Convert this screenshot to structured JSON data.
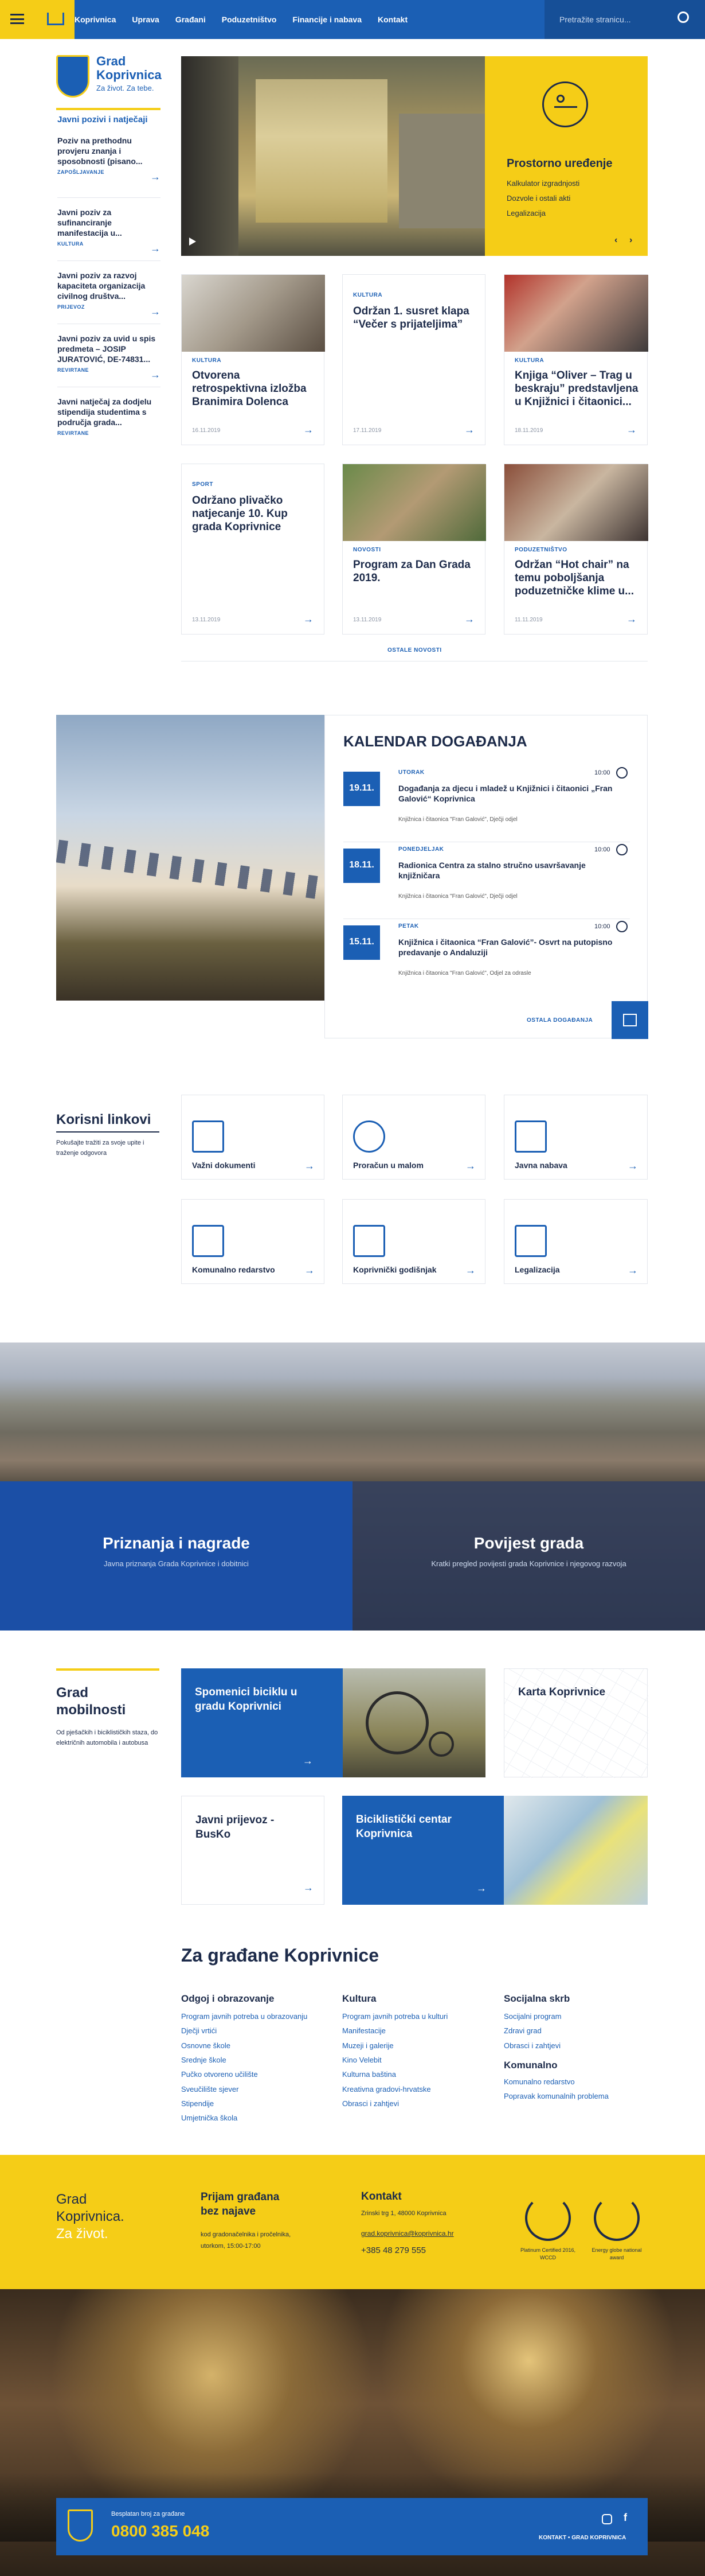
{
  "header": {
    "nav": [
      "Koprivnica",
      "Uprava",
      "Građani",
      "Poduzetništvo",
      "Financije i nabava",
      "Kontakt"
    ],
    "search_placeholder": "Pretražite stranicu..."
  },
  "logo": {
    "title1": "Grad",
    "title2": "Koprivnica",
    "slogan": "Za život. Za tebe."
  },
  "sidebar": {
    "heading": "Javni pozivi i natječaji",
    "items": [
      {
        "title": "Poziv na prethodnu provjeru znanja i sposobnosti (pisano...",
        "tag": "ZAPOŠLJAVANJE"
      },
      {
        "title": "Javni poziv za sufinanciranje manifestacija u...",
        "tag": "KULTURA"
      },
      {
        "title": "Javni poziv za razvoj kapaciteta organizacija civilnog društva...",
        "tag": "PRIJEVOZ"
      },
      {
        "title": "Javni poziv za uvid u spis predmeta – JOSIP JURATOVIĆ, DE-74831...",
        "tag": "REVIRTANE"
      },
      {
        "title": "Javni natječaj za dodjelu stipendija studentima s područja grada...",
        "tag": "REVIRTANE"
      }
    ]
  },
  "hero": {
    "panel_title": "Prostorno uređenje",
    "links": [
      "Kalkulator izgradnjosti",
      "Dozvole i ostali akti",
      "Legalizacija"
    ]
  },
  "news": [
    {
      "tag": "KULTURA",
      "title": "Otvorena retrospektivna izložba Branimira Dolenca",
      "date": "16.11.2019"
    },
    {
      "tag": "KULTURA",
      "title": "Održan 1. susret klapa “Večer s prijateljima”",
      "date": "17.11.2019"
    },
    {
      "tag": "KULTURA",
      "title": "Knjiga “Oliver – Trag u beskraju” predstavljena u Knjižnici i čitaonici...",
      "date": "18.11.2019"
    },
    {
      "tag": "SPORT",
      "title": "Održano plivačko natjecanje 10. Kup grada Koprivnice",
      "date": "13.11.2019"
    },
    {
      "tag": "NOVOSTI",
      "title": "Program za Dan Grada 2019.",
      "date": "13.11.2019"
    },
    {
      "tag": "PODUZETNIŠTVO",
      "title": "Održan “Hot chair” na temu poboljšanja poduzetničke klime u...",
      "date": "11.11.2019"
    }
  ],
  "more_news": "OSTALE NOVOSTI",
  "calendar": {
    "title": "KALENDAR DOGAĐANJA",
    "more": "OSTALA DOGAĐANJA",
    "events": [
      {
        "date": "19.11.",
        "day": "UTORAK",
        "time": "10:00",
        "title": "Događanja za djecu i mladež u Knjižnici i čitaonici „Fran Galović“ Koprivnica",
        "place": "Knjižnica i čitaonica \"Fran Galović\", Dječji odjel"
      },
      {
        "date": "18.11.",
        "day": "PONEDJELJAK",
        "time": "10:00",
        "title": "Radionica Centra za stalno stručno usavršavanje knjižničara",
        "place": "Knjižnica i čitaonica \"Fran Galović\", Dječji odjel"
      },
      {
        "date": "15.11.",
        "day": "PETAK",
        "time": "10:00",
        "title": "Knjižnica i čitaonica “Fran Galović”- Osvrt na putopisno predavanje o Andaluziji",
        "place": "Knjižnica i čitaonica \"Fran Galović\", Odjel za odrasle"
      }
    ]
  },
  "useful": {
    "title": "Korisni linkovi",
    "desc": "Pokušajte tražiti za svoje upite i traženje odgovora",
    "links": [
      "Važni dokumenti",
      "Proračun u malom",
      "Javna nabava",
      "Komunalno redarstvo",
      "Koprivnički godišnjak",
      "Legalizacija"
    ]
  },
  "banner": {
    "left_title": "Priznanja i nagrade",
    "left_sub": "Javna priznanja Grada Koprivnice i dobitnici",
    "right_title": "Povijest grada",
    "right_sub": "Kratki pregled povijesti grada Koprivnice i njegovog razvoja"
  },
  "mobility": {
    "title": "Grad mobilnosti",
    "desc": "Od pješačkih i biciklističkih staza, do električnih automobila i autobusa",
    "cards": [
      "Spomenici biciklu u gradu Koprivnici",
      "Karta Koprivnice",
      "Javni prijevoz - BusKo",
      "Biciklistički centar Koprivnica"
    ]
  },
  "citizens": {
    "title": "Za građane Koprivnice",
    "cols": [
      {
        "head": "Odgoj i obrazovanje",
        "links": [
          "Program javnih potreba u obrazovanju",
          "Dječji vrtići",
          "Osnovne škole",
          "Srednje škole",
          "Pučko otvoreno učilište",
          "Sveučilište sjever",
          "Stipendije",
          "Umjetnička škola"
        ]
      },
      {
        "head": "Kultura",
        "links": [
          "Program javnih potreba u kulturi",
          "Manifestacije",
          "Muzeji i galerije",
          "Kino Velebit",
          "Kulturna baština",
          "Kreativna gradovi-hrvatske",
          "Obrasci i zahtjevi"
        ]
      },
      {
        "head": "Socijalna skrb",
        "links": [
          "Socijalni program",
          "Zdravi grad",
          "Obrasci i zahtjevi"
        ],
        "head2": "Komunalno",
        "links2": [
          "Komunalno redarstvo",
          "Popravak komunalnih problema"
        ]
      }
    ]
  },
  "footer_info": {
    "logo_l1": "Grad",
    "logo_l2": "Koprivnica.",
    "logo_l3": "Za život.",
    "recv_title": "Prijam građana bez najave",
    "recv_text": "kod gradonačelnika i pročelnika, utorkom, 15:00-17:00",
    "contact_title": "Kontakt",
    "address": "Zrinski trg 1, 48000 Koprivnica",
    "email": "grad.koprivnica@koprivnica.hr",
    "phone": "+385 48 279 555",
    "award1": "Platinum Certified 2016, WCCD",
    "award2": "Energy globe national award"
  },
  "bottom": {
    "free_label": "Besplatan broj za građane",
    "phone": "0800 385 048",
    "links": "KONTAKT  •  GRAD KOPRIVNICA"
  }
}
